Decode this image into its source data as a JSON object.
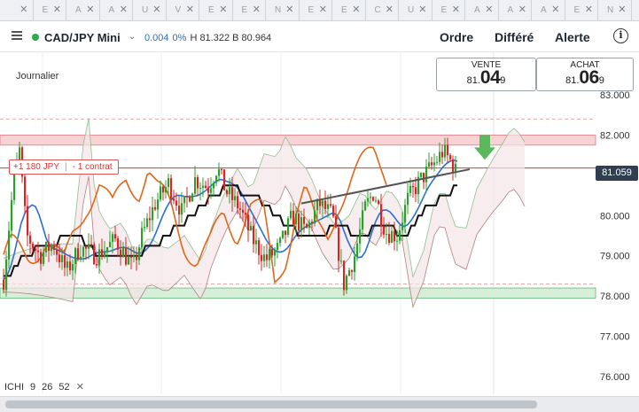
{
  "tabs": [
    {
      "letter": ""
    },
    {
      "letter": "E"
    },
    {
      "letter": "A"
    },
    {
      "letter": "A"
    },
    {
      "letter": "U"
    },
    {
      "letter": "V"
    },
    {
      "letter": "E"
    },
    {
      "letter": "E"
    },
    {
      "letter": "N"
    },
    {
      "letter": "E"
    },
    {
      "letter": "E"
    },
    {
      "letter": "C"
    },
    {
      "letter": "U"
    },
    {
      "letter": "E"
    },
    {
      "letter": "A"
    },
    {
      "letter": "A"
    },
    {
      "letter": "A"
    },
    {
      "letter": "E"
    },
    {
      "letter": "N"
    }
  ],
  "tab_close": "✕",
  "header": {
    "symbol": "CAD/JPY Mini",
    "change": "0.004",
    "change_pct": "0%",
    "high_low": "H 81.322 B 80.964",
    "order_label": "Ordre",
    "deferred_label": "Différé",
    "alert_label": "Alerte",
    "info_glyph": "i"
  },
  "period_label": "Journalier",
  "sell": {
    "label": "VENTE",
    "prefix": "81.",
    "big": "04",
    "suffix": "9"
  },
  "buy": {
    "label": "ACHAT",
    "prefix": "81.",
    "big": "06",
    "suffix": "9"
  },
  "position": {
    "pnl": "+1 180 JPY",
    "size": "- 1 contrat"
  },
  "last_price": "81.059",
  "y_axis_labels": [
    "83.000",
    "82.000",
    "81.000",
    "80.000",
    "79.000",
    "78.000",
    "77.000",
    "76.000"
  ],
  "ichimoku": {
    "label": "ICHI",
    "params": [
      "9",
      "26",
      "52"
    ],
    "remove": "✕"
  },
  "colors": {
    "up": "#2ca02c",
    "down": "#d62728",
    "tenkan": "#2a6fd6",
    "kijun": "#111111",
    "chikou": "#e0661a",
    "resistance_zone": "#f7d3d5",
    "support_zone": "#d6efd9",
    "sell_arrow": "#5cb85c",
    "status_online": "#2eaa4c"
  },
  "chart_data": {
    "type": "candlestick",
    "y_range": [
      75.8,
      83.3
    ],
    "resistance_zone": [
      81.75,
      82.0
    ],
    "support_zone": [
      77.95,
      78.2
    ],
    "dashed_levels": [
      82.4,
      81.18,
      78.3
    ]
  }
}
